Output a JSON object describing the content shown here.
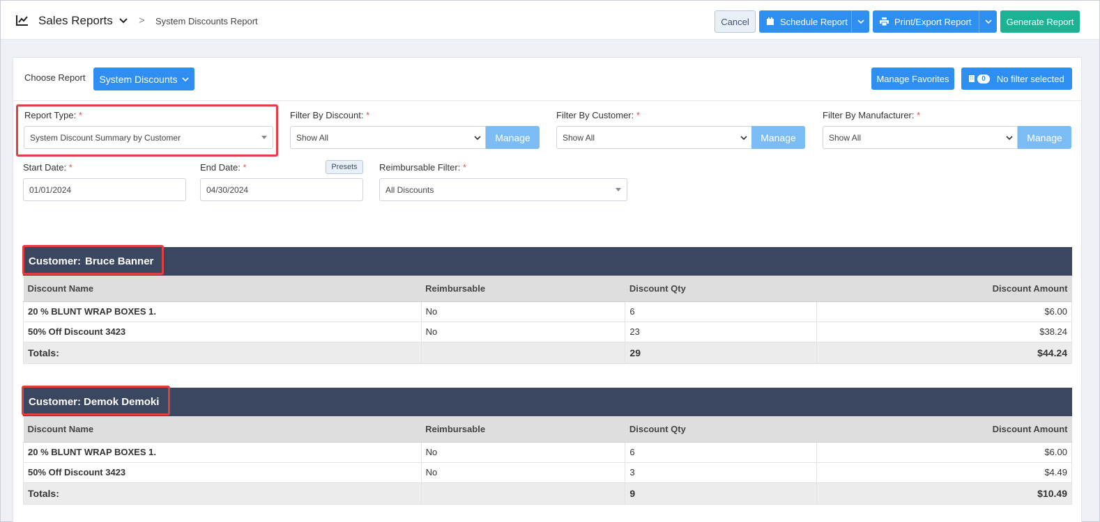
{
  "header": {
    "title": "Sales Reports",
    "breadcrumb_separator": ">",
    "breadcrumb": "System Discounts Report",
    "cancel_label": "Cancel",
    "schedule_label": "Schedule Report",
    "print_label": "Print/Export Report",
    "generate_label": "Generate Report",
    "icons": [
      "chart-line-icon",
      "chevron-down-icon",
      "calendar-icon",
      "printer-icon"
    ]
  },
  "toolbar": {
    "choose_label": "Choose Report",
    "choose_value": "System Discounts",
    "favorites_label": "Manage Favorites",
    "filter_count": "0",
    "filter_label": "No filter selected"
  },
  "filters": {
    "report_type_label": "Report Type:",
    "report_type_value": "System Discount Summary by Customer",
    "discount_label": "Filter By Discount:",
    "discount_value": "Show All",
    "customer_label": "Filter By Customer:",
    "customer_value": "Show All",
    "manufacturer_label": "Filter By Manufacturer:",
    "manufacturer_value": "Show All",
    "manage_label": "Manage",
    "start_label": "Start Date:",
    "start_value": "01/01/2024",
    "end_label": "End Date:",
    "end_value": "04/30/2024",
    "presets_label": "Presets",
    "reimb_label": "Reimbursable Filter:",
    "reimb_value": "All Discounts",
    "required_mark": "*"
  },
  "columns": [
    "Discount Name",
    "Reimbursable",
    "Discount Qty",
    "Discount Amount"
  ],
  "customers": [
    {
      "label": "Customer:",
      "name": "Bruce Banner",
      "rows": [
        {
          "name": "20 % BLUNT WRAP BOXES 1.",
          "reimb": "No",
          "qty": "6",
          "amount": "$6.00"
        },
        {
          "name": "50% Off Discount 3423",
          "reimb": "No",
          "qty": "23",
          "amount": "$38.24"
        }
      ],
      "totals": {
        "label": "Totals:",
        "qty": "29",
        "amount": "$44.24"
      }
    },
    {
      "label": "Customer:",
      "name": "Demok Demoki",
      "rows": [
        {
          "name": "20 % BLUNT WRAP BOXES 1.",
          "reimb": "No",
          "qty": "6",
          "amount": "$6.00"
        },
        {
          "name": "50% Off Discount 3423",
          "reimb": "No",
          "qty": "3",
          "amount": "$4.49"
        }
      ],
      "totals": {
        "label": "Totals:",
        "qty": "9",
        "amount": "$10.49"
      }
    }
  ],
  "colors": {
    "primary": "#2e8ff1",
    "success": "#1bb394",
    "header_bar": "#3b4661",
    "highlight": "#e0403f",
    "manage": "#7bbcf5"
  }
}
